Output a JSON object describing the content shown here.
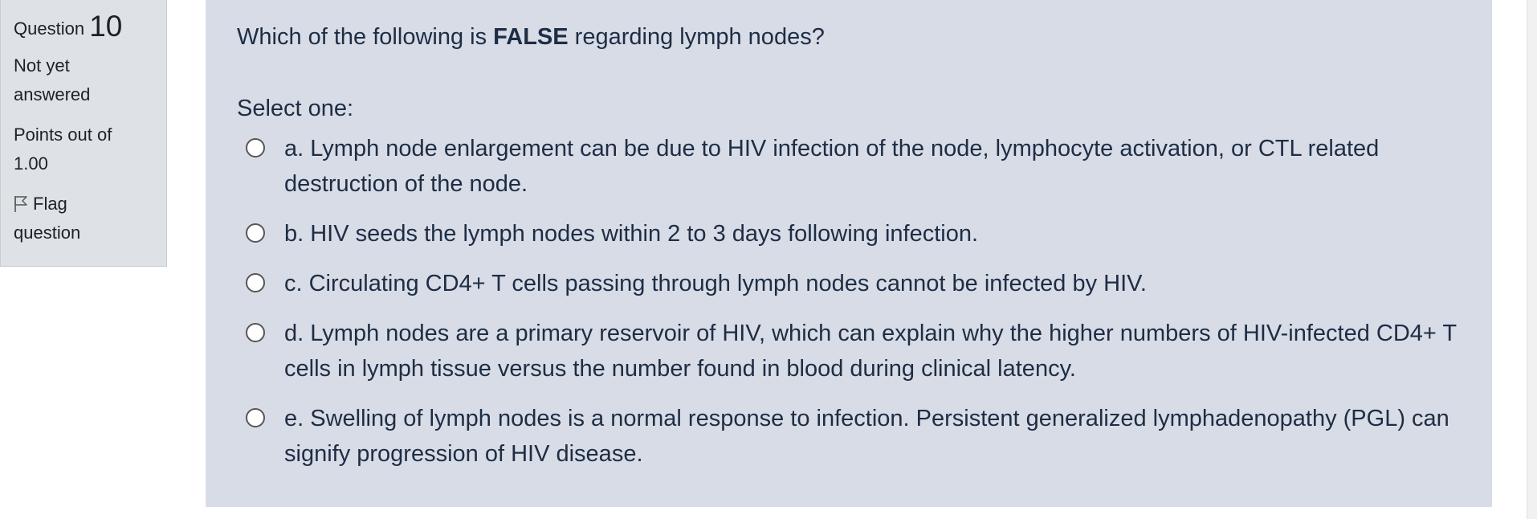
{
  "info": {
    "question_word": "Question",
    "question_number": "10",
    "state_line1": "Not yet",
    "state_line2": "answered",
    "grade_line1": "Points out of",
    "grade_line2": "1.00",
    "flag_line1": "Flag",
    "flag_line2": "question",
    "flag_icon": "flag-icon"
  },
  "question": {
    "text_before": "Which of the following is ",
    "text_bold": "FALSE",
    "text_after": " regarding lymph nodes?",
    "prompt": "Select one:"
  },
  "options": [
    {
      "label": "a. Lymph node enlargement can be due to HIV infection of the node, lymphocyte activation, or CTL related destruction of the node."
    },
    {
      "label": "b. HIV seeds the lymph nodes within 2 to 3 days following infection."
    },
    {
      "label": "c. Circulating CD4+ T cells passing through lymph nodes cannot be infected by HIV."
    },
    {
      "label": "d. Lymph nodes are a primary reservoir of HIV, which can explain why the higher numbers of HIV-infected CD4+ T cells in lymph tissue versus the number found in blood during clinical latency."
    },
    {
      "label": "e. Swelling of lymph nodes is a normal response to infection. Persistent generalized lymphadenopathy (PGL) can signify progression of HIV disease."
    }
  ],
  "colors": {
    "info_bg": "#dee2e6",
    "content_bg": "#d8dce6",
    "text": "#1d2d44"
  }
}
